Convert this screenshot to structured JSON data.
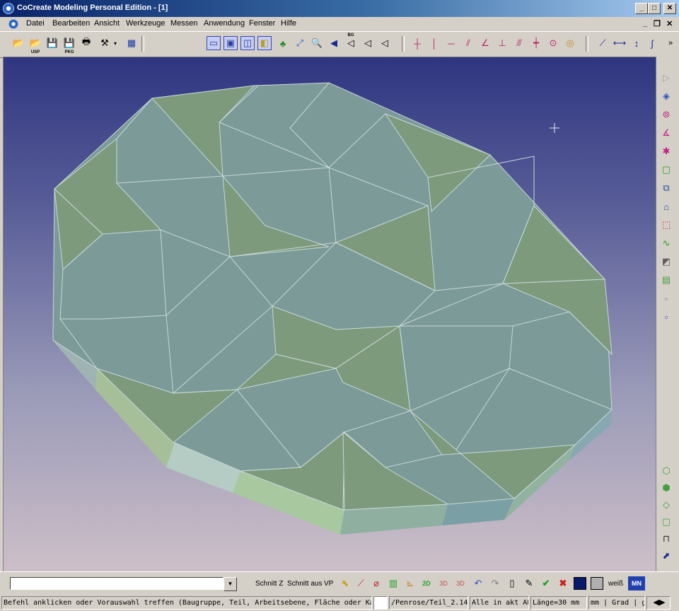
{
  "window": {
    "title": "CoCreate Modeling Personal Edition - [1]",
    "min": "_",
    "max": "□",
    "close": "✕"
  },
  "menu": [
    "Datei",
    "Bearbeiten",
    "Ansicht",
    "Werkzeuge",
    "Messen",
    "Anwendung",
    "Fenster",
    "Hilfe"
  ],
  "mdi": {
    "min": "_",
    "restore": "❐",
    "close": "✕"
  },
  "toolbar": {
    "usp_label": "USP",
    "pkg_label": "PKG",
    "bg_label": "BG",
    "overflow": "»"
  },
  "rightbar": {
    "overflow": "»"
  },
  "bottom": {
    "schnitt_z": "Schnitt Z",
    "schnitt_aus": "Schnitt aus",
    "vp": "VP",
    "label_2d": "2D",
    "label_3d": "3D",
    "weiss": "weiß",
    "mn": "MN"
  },
  "status": {
    "message": "Befehl anklicken oder Vorauswahl treffen (Baugruppe, Teil, Arbeitsebene, Fläche oder Kante). Umschalten",
    "path": "/Penrose/Teil_2.14",
    "mode": "Alle in akt AE",
    "length": "Länge=30 mm",
    "units": "mm | Grad | g"
  },
  "colors": {
    "tile_blue": "#7b9a98",
    "tile_green": "#7d9a7d",
    "title_start": "#0a246a",
    "title_end": "#a6caf0"
  }
}
